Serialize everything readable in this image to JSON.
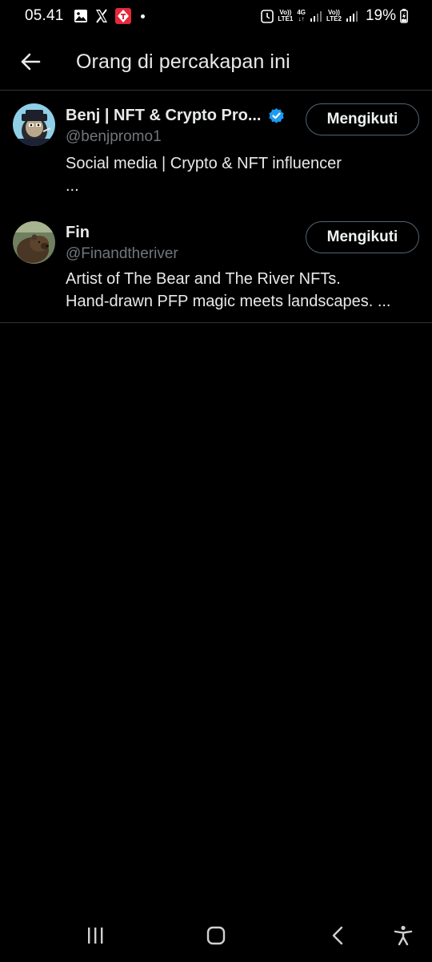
{
  "status_bar": {
    "time": "05.41",
    "sim1_top": "Vo))",
    "sim1_bottom": "LTE1",
    "net_top": "4G",
    "net_bottom": "↓↑",
    "sim2_top": "Vo))",
    "sim2_bottom": "LTE2",
    "battery": "19%"
  },
  "header": {
    "title": "Orang di percakapan ini"
  },
  "users": [
    {
      "name": "Benj | NFT & Crypto Pro...",
      "handle": "@benjpromo1",
      "bio": "Social media | Crypto & NFT influencer\n  ...",
      "verified": true,
      "follow_label": "Mengikuti"
    },
    {
      "name": "Fin",
      "handle": "@Finandtheriver",
      "bio": "Artist of The Bear and The River NFTs.\nHand-drawn PFP magic meets landscapes. ...",
      "verified": false,
      "follow_label": "Mengikuti"
    }
  ],
  "colors": {
    "background": "#000000",
    "text_primary": "#e7e9ea",
    "text_secondary": "#71767b",
    "divider": "#2f3336",
    "button_border": "#536471",
    "verified": "#1d9bf0"
  },
  "icons": {
    "back": "arrow-left-icon",
    "verified": "verified-badge-icon",
    "nav_recents": "recents-icon",
    "nav_home": "home-icon",
    "nav_back": "back-chevron-icon",
    "nav_accessibility": "accessibility-icon"
  }
}
